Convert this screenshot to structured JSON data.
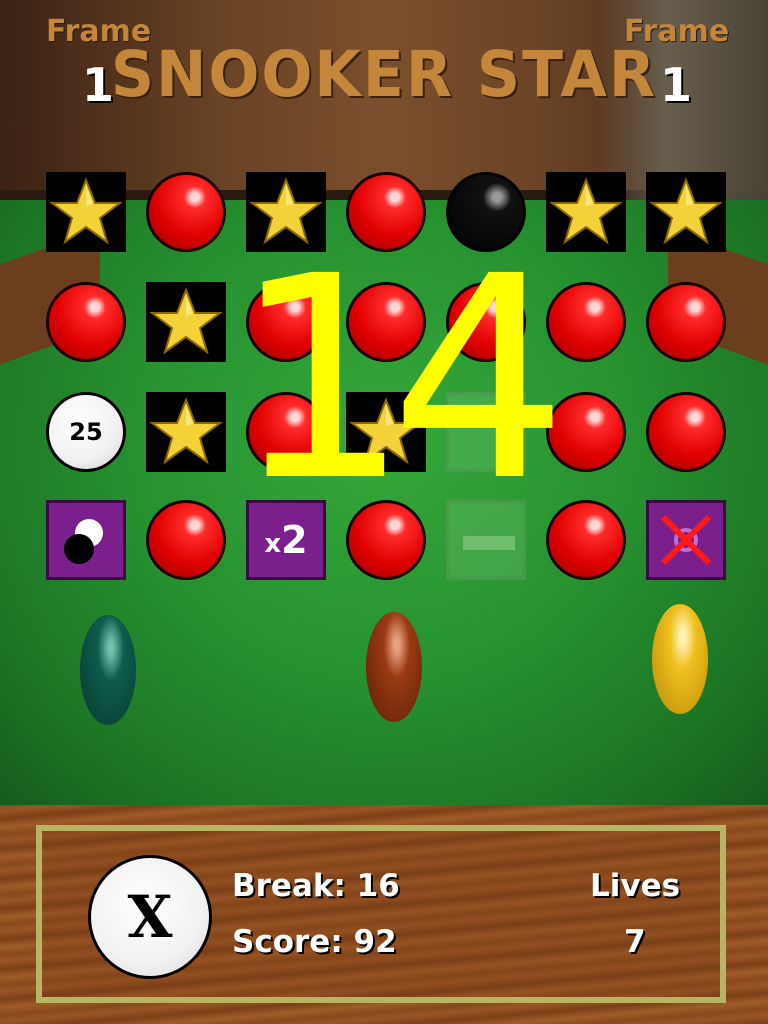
{
  "header": {
    "title": "SNOOKER STAR",
    "left_frame": {
      "label": "Frame",
      "value": "1"
    },
    "right_frame": {
      "label": "Frame",
      "value": "1"
    }
  },
  "board": {
    "countdown": "14",
    "bonus_ball_value": "25",
    "multiplier": {
      "prefix": "x",
      "value": "2"
    },
    "rows": [
      [
        "star",
        "red",
        "star",
        "red",
        "black",
        "star",
        "star"
      ],
      [
        "red",
        "star",
        "red",
        "red",
        "red",
        "red",
        "red"
      ],
      [
        "bonus",
        "star",
        "red",
        "star",
        "ghost",
        "red",
        "red"
      ],
      [
        "cueball-tile",
        "red",
        "multiplier",
        "red",
        "ghost-bar",
        "red",
        "crossed-tile"
      ]
    ]
  },
  "footer": {
    "cue_button_label": "X",
    "break_label": "Break:",
    "break_value": "16",
    "score_label": "Score:",
    "score_value": "92",
    "lives_label": "Lives",
    "lives_value": "7"
  },
  "colors": {
    "title": "#c3863a",
    "countdown": "#ffff00",
    "red_ball": "#e00000",
    "purple_tile": "#7a1f8c",
    "panel_border": "#b7b563"
  }
}
